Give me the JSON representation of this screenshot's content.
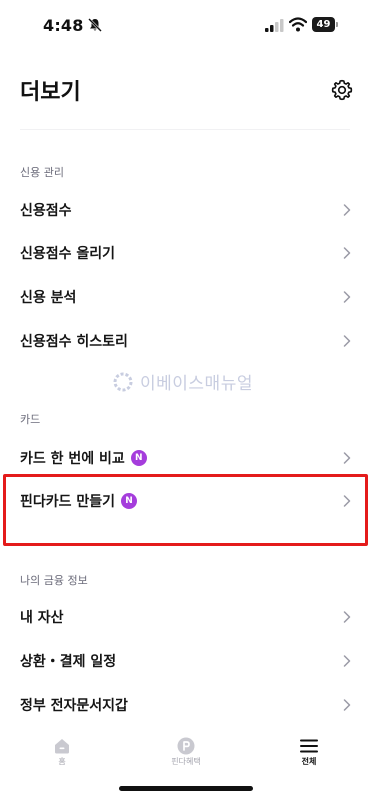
{
  "status_bar": {
    "time": "4:48",
    "battery": "49"
  },
  "header": {
    "title": "더보기"
  },
  "sections": {
    "credit": {
      "title": "신용 관리",
      "items": [
        {
          "label": "신용점수"
        },
        {
          "label": "신용점수 올리기"
        },
        {
          "label": "신용 분석"
        },
        {
          "label": "신용점수 히스토리"
        }
      ]
    },
    "card": {
      "title": "카드",
      "items": [
        {
          "label": "카드 한 번에 비교",
          "badge": "N"
        },
        {
          "label": "핀다카드 만들기",
          "badge": "N"
        }
      ]
    },
    "finance": {
      "title": "나의 금융 정보",
      "items": [
        {
          "label": "내 자산"
        },
        {
          "label": "상환・결제 일정"
        },
        {
          "label": "정부 전자문서지갑"
        }
      ]
    }
  },
  "watermark": {
    "text": "이베이스매뉴얼"
  },
  "tab_bar": {
    "tabs": [
      {
        "label": "홈",
        "icon": "home-icon"
      },
      {
        "label": "핀다혜택",
        "icon": "benefit-p-icon"
      },
      {
        "label": "전체",
        "icon": "menu-icon"
      }
    ],
    "active": "전체"
  },
  "colors": {
    "accent_badge": "#a53ddc",
    "highlight": "#e41b1b",
    "muted_text": "#a4a4ae"
  }
}
